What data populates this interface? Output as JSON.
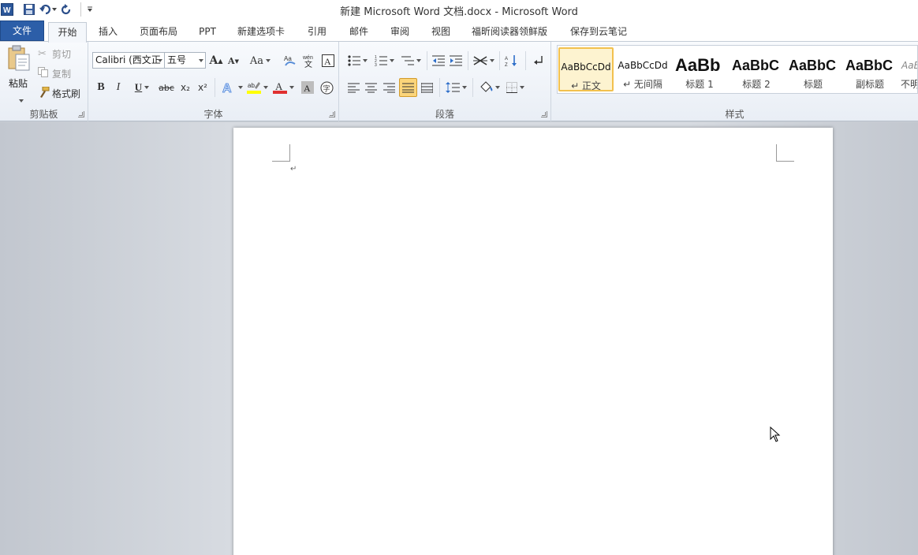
{
  "window": {
    "title": "新建 Microsoft Word 文档.docx  -  Microsoft Word"
  },
  "quick_access": {
    "icons": [
      "word-app-icon",
      "save-icon",
      "undo-icon",
      "redo-icon",
      "customize-qat-icon"
    ]
  },
  "tabs": [
    {
      "label": "文件"
    },
    {
      "label": "开始"
    },
    {
      "label": "插入"
    },
    {
      "label": "页面布局"
    },
    {
      "label": "PPT"
    },
    {
      "label": "新建选项卡"
    },
    {
      "label": "引用"
    },
    {
      "label": "邮件"
    },
    {
      "label": "审阅"
    },
    {
      "label": "视图"
    },
    {
      "label": "福昕阅读器领鲜版"
    },
    {
      "label": "保存到云笔记"
    }
  ],
  "active_tab": "开始",
  "clipboard": {
    "label": "剪贴板",
    "paste": "粘贴",
    "cut": "剪切",
    "copy": "复制",
    "format_painter": "格式刷"
  },
  "font": {
    "label": "字体",
    "font_name": "Calibri (西文正",
    "font_size": "五号",
    "grow": "A",
    "shrink": "A",
    "change_case": "Aa",
    "bold": "B",
    "italic": "I",
    "underline": "U",
    "strike": "abc",
    "subscript": "x₂",
    "superscript": "x²"
  },
  "paragraph": {
    "label": "段落"
  },
  "styles": {
    "label": "样式",
    "items": [
      {
        "preview": "AaBbCcDd",
        "name": "↵ 正文",
        "selected": true
      },
      {
        "preview": "AaBbCcDd",
        "name": "↵ 无间隔",
        "selected": false
      },
      {
        "preview": "AaBb",
        "name": "标题 1",
        "selected": false
      },
      {
        "preview": "AaBbC",
        "name": "标题 2",
        "selected": false
      },
      {
        "preview": "AaBbC",
        "name": "标题",
        "selected": false
      },
      {
        "preview": "AaBbC",
        "name": "副标题",
        "selected": false
      },
      {
        "preview": "AaB",
        "name": "不明",
        "selected": false
      }
    ]
  },
  "document": {
    "paragraph_mark": "↵"
  },
  "colors": {
    "file_tab": "#2c5ea8",
    "highlight": "#ffff00",
    "font_color": "#e03030",
    "selected_style": "#f2c14e"
  }
}
